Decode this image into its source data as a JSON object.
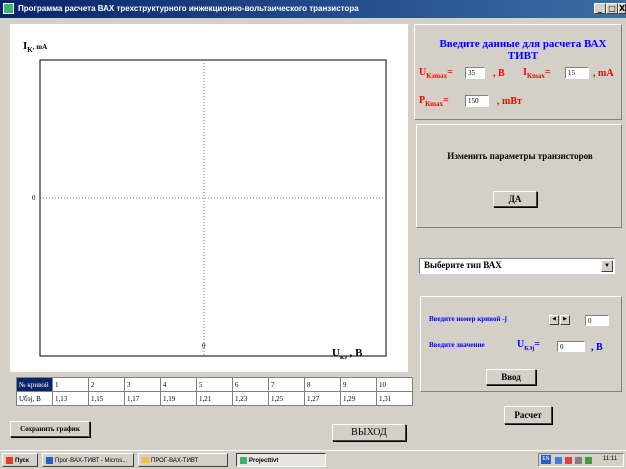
{
  "window": {
    "title": "Программа расчета ВАХ трехструктурного инжекционно-вольтаического транзистора",
    "controls": [
      "_",
      "□",
      "X"
    ]
  },
  "plot": {
    "y_axis_label": "I",
    "y_axis_sub": "K",
    "y_axis_unit": ", mA",
    "y_zero_label": "0",
    "x_zero_label": "0",
    "x_axis_label": "U",
    "x_axis_sub": "кэ",
    "x_axis_unit": " , В"
  },
  "params": {
    "heading": "Введите данные для расчета ВАХ ТИВТ",
    "u_label": "U",
    "u_sub": "Кэmax",
    "u_eq": "=",
    "u_value": "35",
    "u_unit": ", В",
    "i_label": "I",
    "i_sub": "Кmax",
    "i_eq": "=",
    "i_value": "15",
    "i_unit": ", mA",
    "p_label": "P",
    "p_sub": "Кmax",
    "p_eq": "=",
    "p_value": "150",
    "p_unit": ", mВт"
  },
  "change_params": {
    "label": "Изменить параметры транзисторов",
    "yes_button": "ДА"
  },
  "vah_select": {
    "selected": "Выберите тип ВАХ"
  },
  "curve_input": {
    "curve_label": "Введите номер кривой -j",
    "curve_value": "0",
    "value_label": "Введите значение",
    "u_label": "U",
    "u_sub": "БЭj",
    "u_eq": "=",
    "u_value": "0",
    "u_unit": ", В",
    "enter_button": "Ввод"
  },
  "calc_button": "Расчет",
  "save_button": "Сохранить график",
  "exit_button": "ВЫХОД",
  "curves_table": {
    "row1_header": "№ кривой",
    "numbers": [
      "1",
      "2",
      "3",
      "4",
      "5",
      "6",
      "7",
      "8",
      "9",
      "10"
    ],
    "row2_header": "Uбэj, В",
    "values": [
      "1,13",
      "1,15",
      "1,17",
      "1,19",
      "1,21",
      "1,23",
      "1,25",
      "1,27",
      "1,29",
      "1,31"
    ]
  },
  "taskbar": {
    "start": "Пуск",
    "items": [
      "Прог-ВАХ-ТИВТ - Micros...",
      "ПРОГ-ВАХ-ТИВТ",
      "Projecttivt"
    ],
    "lang": "EN",
    "clock": "11:11"
  },
  "colors": {
    "title_bar": "#0a246a",
    "panel": "#d4d0c8",
    "red": "#ff0000",
    "blue": "#0000ff"
  }
}
